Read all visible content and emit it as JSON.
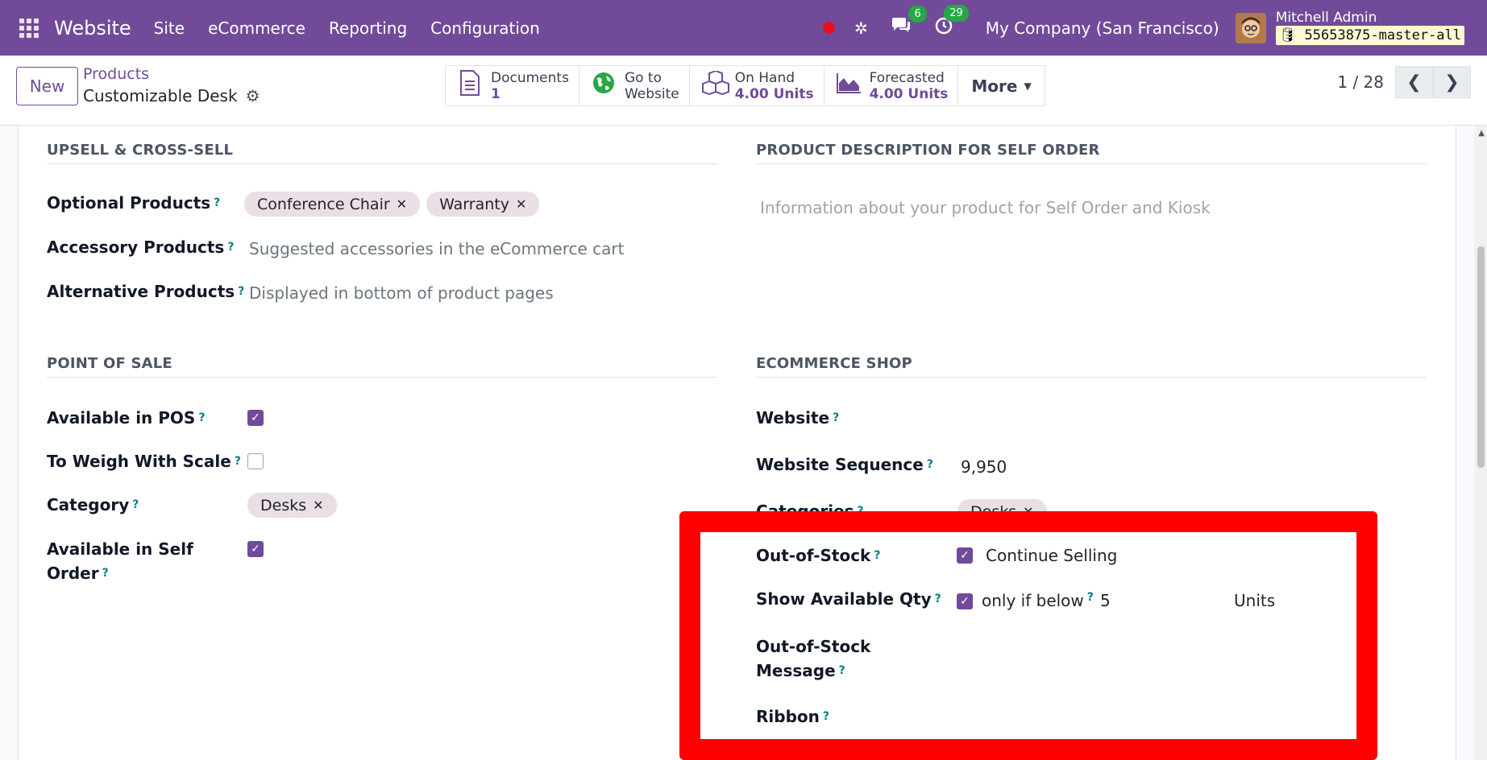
{
  "navbar": {
    "brand": "Website",
    "menu": [
      "Site",
      "eCommerce",
      "Reporting",
      "Configuration"
    ],
    "messages_count": "6",
    "activities_count": "29",
    "company": "My Company (San Francisco)",
    "user_name": "Mitchell Admin",
    "db_name": "55653875-master-all"
  },
  "control": {
    "new_label": "New",
    "breadcrumb": "Products",
    "record_title": "Customizable Desk",
    "smart_buttons": {
      "documents_label": "Documents",
      "documents_value": "1",
      "website_label_1": "Go to",
      "website_label_2": "Website",
      "onhand_label": "On Hand",
      "onhand_value": "4.00 Units",
      "forecasted_label": "Forecasted",
      "forecasted_value": "4.00 Units",
      "more_label": "More"
    },
    "pager": "1 / 28"
  },
  "upsell": {
    "title": "UPSELL & CROSS-SELL",
    "optional_label": "Optional Products",
    "optional_tags": [
      "Conference Chair",
      "Warranty"
    ],
    "accessory_label": "Accessory Products",
    "accessory_placeholder": "Suggested accessories in the eCommerce cart",
    "alternative_label": "Alternative Products",
    "alternative_placeholder": "Displayed in bottom of product pages"
  },
  "self_order": {
    "title": "PRODUCT DESCRIPTION FOR SELF ORDER",
    "placeholder": "Information about your product for Self Order and Kiosk"
  },
  "pos": {
    "title": "POINT OF SALE",
    "available_label": "Available in POS",
    "available_checked": true,
    "weigh_label": "To Weigh With Scale",
    "weigh_checked": false,
    "category_label": "Category",
    "category_tag": "Desks",
    "self_order_label_1": "Available in Self",
    "self_order_label_2": "Order",
    "self_order_checked": true
  },
  "ecommerce": {
    "title": "ECOMMERCE SHOP",
    "website_label": "Website",
    "sequence_label": "Website Sequence",
    "sequence_value": "9,950",
    "categories_label": "Categories",
    "categories_tag": "Desks",
    "oos_label": "Out-of-Stock",
    "continue_selling": "Continue Selling",
    "show_qty_label": "Show Available Qty",
    "only_if_below": "only if below",
    "threshold": "5",
    "units": "Units",
    "oos_message_label_1": "Out-of-Stock",
    "oos_message_label_2": "Message",
    "ribbon_label": "Ribbon"
  },
  "colors": {
    "brand": "#714b9a",
    "highlight": "#ff0000",
    "help": "#017e84"
  }
}
